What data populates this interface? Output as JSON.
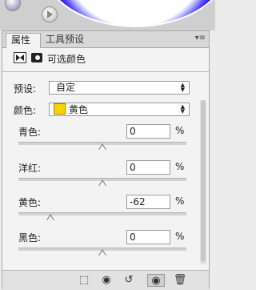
{
  "panel": {
    "tabs": [
      {
        "label": "属性"
      },
      {
        "label": "工具预设"
      }
    ],
    "menu_icon": "panel-menu-icon",
    "title": "可选颜色",
    "preset_label": "预设:",
    "preset_value": "自定",
    "colors_label": "颜色:",
    "colors_value": "黄色",
    "colors_swatch": "#f7d300",
    "sliders": [
      {
        "label": "青色:",
        "value": "0",
        "unit": "%",
        "position": 0.5
      },
      {
        "label": "洋红:",
        "value": "0",
        "unit": "%",
        "position": 0.5
      },
      {
        "label": "黄色:",
        "value": "-62",
        "unit": "%",
        "position": 0.19
      },
      {
        "label": "黑色:",
        "value": "0",
        "unit": "%",
        "position": 0.5
      }
    ],
    "bottom_icons": [
      "clip-to-layer-icon",
      "view-previous-icon",
      "reset-icon",
      "visibility-icon",
      "delete-icon"
    ]
  }
}
